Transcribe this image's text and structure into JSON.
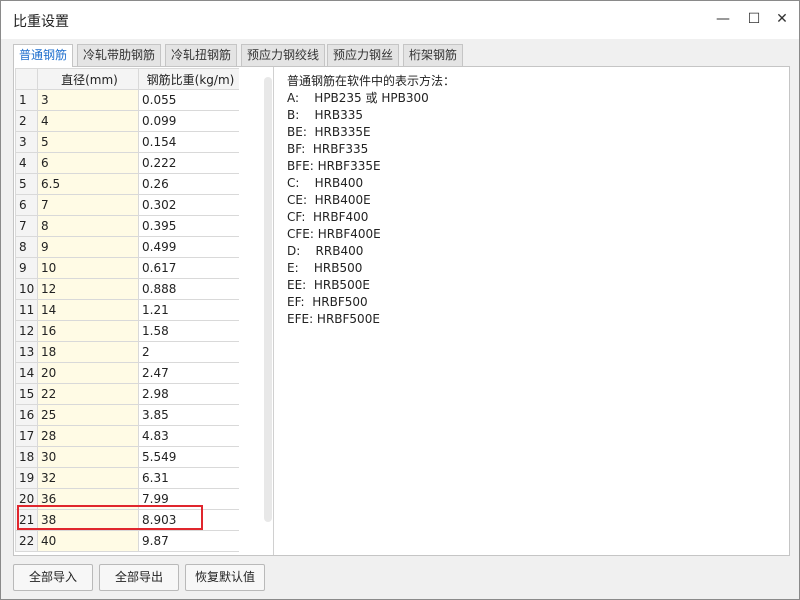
{
  "window": {
    "title": "比重设置",
    "minimize_icon": "minimize-icon",
    "maximize_icon": "maximize-icon",
    "close_icon": "close-icon"
  },
  "tabs": [
    {
      "label": "普通钢筋",
      "active": true
    },
    {
      "label": "冷轧带肋钢筋",
      "active": false
    },
    {
      "label": "冷轧扭钢筋",
      "active": false
    },
    {
      "label": "预应力钢绞线",
      "active": false
    },
    {
      "label": "预应力钢丝",
      "active": false
    },
    {
      "label": "桁架钢筋",
      "active": false
    }
  ],
  "table": {
    "columns": [
      "直径(mm)",
      "钢筋比重(kg/m)"
    ],
    "rows": [
      [
        "1",
        "3",
        "0.055"
      ],
      [
        "2",
        "4",
        "0.099"
      ],
      [
        "3",
        "5",
        "0.154"
      ],
      [
        "4",
        "6",
        "0.222"
      ],
      [
        "5",
        "6.5",
        "0.26"
      ],
      [
        "6",
        "7",
        "0.302"
      ],
      [
        "7",
        "8",
        "0.395"
      ],
      [
        "8",
        "9",
        "0.499"
      ],
      [
        "9",
        "10",
        "0.617"
      ],
      [
        "10",
        "12",
        "0.888"
      ],
      [
        "11",
        "14",
        "1.21"
      ],
      [
        "12",
        "16",
        "1.58"
      ],
      [
        "13",
        "18",
        "2"
      ],
      [
        "14",
        "20",
        "2.47"
      ],
      [
        "15",
        "22",
        "2.98"
      ],
      [
        "16",
        "25",
        "3.85"
      ],
      [
        "17",
        "28",
        "4.83"
      ],
      [
        "18",
        "30",
        "5.549"
      ],
      [
        "19",
        "32",
        "6.31"
      ],
      [
        "20",
        "36",
        "7.99"
      ],
      [
        "21",
        "38",
        "8.903"
      ],
      [
        "22",
        "40",
        "9.87"
      ]
    ],
    "highlighted_row": "21",
    "highlight_color": "#e0262d"
  },
  "notes": {
    "heading": "普通钢筋在软件中的表示方法：",
    "lines": [
      "A:    HPB235 或 HPB300",
      "B:    HRB335",
      "BE:  HRB335E",
      "BF:  HRBF335",
      "BFE: HRBF335E",
      "C:    HRB400",
      "CE:  HRB400E",
      "CF:  HRBF400",
      "CFE: HRBF400E",
      "D:    RRB400",
      "E:    HRB500",
      "EE:  HRB500E",
      "EF:  HRBF500",
      "EFE: HRBF500E"
    ]
  },
  "buttons": {
    "import_all": "全部导入",
    "export_all": "全部导出",
    "restore_default": "恢复默认值"
  },
  "colors": {
    "active_tab_text": "#1e6ecd",
    "diameter_column_bg": "#fffbe5"
  }
}
